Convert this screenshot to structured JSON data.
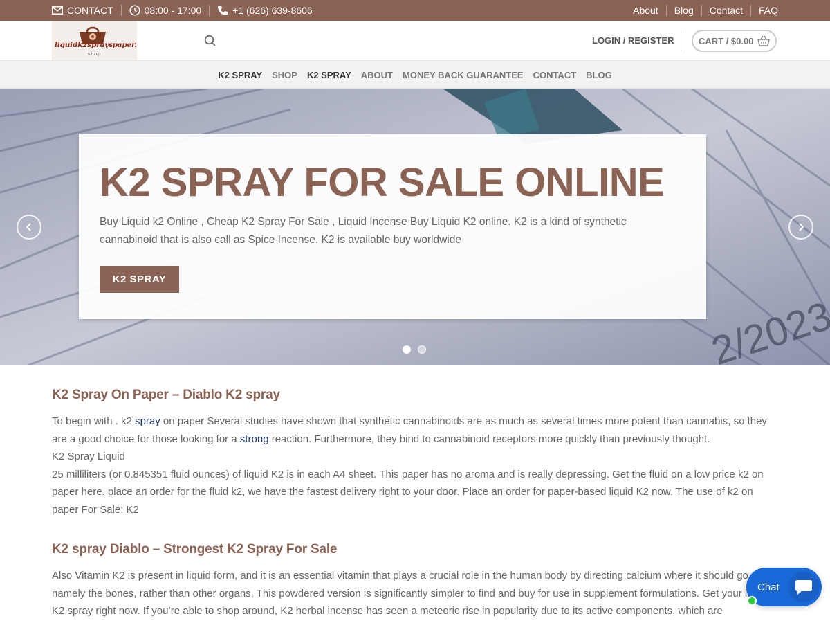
{
  "topbar": {
    "contact": "CONTACT",
    "hours": "08:00 - 17:00",
    "phone": "+1 (626) 639-8606",
    "links": [
      "About",
      "Blog",
      "Contact",
      "FAQ"
    ]
  },
  "header": {
    "logo_text": "liquidk2sprayspaper.",
    "logo_sub": "shop",
    "login": "LOGIN / REGISTER",
    "cart": "CART / $0.00"
  },
  "nav": [
    "K2 SPRAY",
    "SHOP",
    "K2 SPRAY",
    "ABOUT",
    "MONEY BACK GUARANTEE",
    "CONTACT",
    "BLOG"
  ],
  "hero": {
    "title": "K2 SPRAY FOR SALE ONLINE",
    "text": "Buy Liquid k2 Online , Cheap K2 Spray For Sale , Liquid Incense Buy Liquid K2 online. K2 is a kind of synthetic cannabinoid that is also call as Spice Incense. K2 is  available buy worldwide",
    "button": "K2 SPRAY",
    "bg_text": "2/2023"
  },
  "content": {
    "h1": "K2 Spray On Paper  –  Diablo K2 spray",
    "p1_a": "To begin with . k2 ",
    "p1_link1": "spray",
    "p1_b": " on paper Several studies have shown that synthetic cannabinoids are as much as several times more potent than cannabis, so they are a good choice for those looking for a ",
    "p1_link2": "strong",
    "p1_c": " reaction. Furthermore, they bind to cannabinoid receptors more quickly than previously thought.",
    "p1_line2": "K2 Spray Liquid",
    "p1_line3": "25 milliliters (or 0.845351 fluid ounces) of liquid K2 is in each A4 sheet. This paper has no aroma and is really depressing. Get the  fluid on a low price k2 on paper here. place an order  for the  fluid k2, we have the fastest  delivery right to your door. Place an order for paper-based liquid K2 now. The use of k2 on paper For Sale: K2",
    "h2": "K2 spray  Diablo  –  Strongest K2 Spray For Sale",
    "p2": "Also Vitamin K2 is present in liquid form, and it is an essential vitamin that plays a crucial role in the human body by directing calcium where it should go, namely the bones, rather than other organs. This powdered version is significantly simpler to find and buy for use in supplement formulations. Get your liquid K2 spray right now. If you’re able to shop around, K2 herbal incense has seen a meteoric rise in popularity due to its active components, which are"
  },
  "chat": {
    "label": "Chat"
  },
  "colors": {
    "brand": "#8b6355",
    "chat": "#1669d7",
    "link": "#1e3a73"
  }
}
